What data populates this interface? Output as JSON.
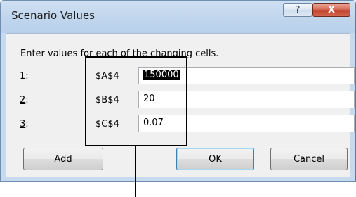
{
  "dialog": {
    "title": "Scenario Values",
    "help_glyph": "?",
    "close_glyph": "X",
    "instruction": "Enter values for each of the changing cells.",
    "rows": [
      {
        "num": "1",
        "suffix": ":",
        "cell": "$A$4",
        "value": "150000"
      },
      {
        "num": "2",
        "suffix": ":",
        "cell": "$B$4",
        "value": "20"
      },
      {
        "num": "3",
        "suffix": ":",
        "cell": "$C$4",
        "value": "0.07"
      }
    ],
    "buttons": {
      "add_mnemonic": "A",
      "add_rest": "dd",
      "ok": "OK",
      "cancel": "Cancel"
    }
  }
}
